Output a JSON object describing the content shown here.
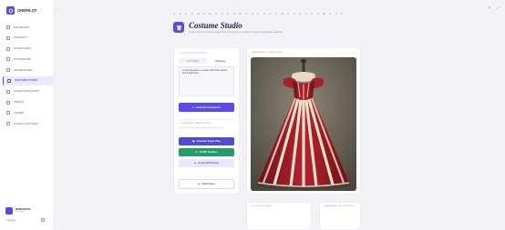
{
  "app": {
    "logo_text": "ONEPILOT",
    "collapse_icon": "‹‹"
  },
  "sidebar": {
    "items": [
      {
        "label": "DASHBOARD",
        "icon": "home-icon"
      },
      {
        "label": "PROJECTS",
        "icon": "folder-icon"
      },
      {
        "label": "CHARACTERS",
        "icon": "user-icon"
      },
      {
        "label": "STORYBOARD",
        "icon": "grid-icon"
      },
      {
        "label": "ONLINE MODEL",
        "icon": "cube-icon"
      },
      {
        "label": "COSTUME STUDIO",
        "icon": "shirt-icon",
        "active": true
      },
      {
        "label": "CHARACTER STUDIO",
        "icon": "face-icon"
      },
      {
        "label": "ASSETS",
        "icon": "image-icon"
      },
      {
        "label": "SHARED",
        "icon": "share-icon"
      },
      {
        "label": "USAGE & SETTINGS",
        "icon": "gear-icon"
      }
    ],
    "account": {
      "name": "WORKSPACE",
      "plan": "Free plan"
    },
    "upgrade": "• Upgrade"
  },
  "header": {
    "title": "Costume Studio",
    "subtitle": "Create character costume designs from text prompts or reference images and generate variations."
  },
  "left_panel": {
    "section1": "1. DESIGN DESCRIPTION",
    "tabs": [
      "Text Prompt",
      "Reference"
    ],
    "prompt_text": "A red long gown in a gown with white stripes and cream layer",
    "generate_button": "Generate Concept Art",
    "section2": "2. GENERATE VIEWS OF ART",
    "section2_hint": "Select the output after generating the concept",
    "single_view_button": "Generate Single View",
    "rotation_button": "AI 360° Rotation",
    "preview_button": "Instant 3D Preview",
    "new_project_button": "New Project"
  },
  "right_panel": {
    "title": "GENERATED CONCEPT ART",
    "close": "×"
  },
  "bottom_panels": {
    "left_title": "3D SINGLE VIEWS",
    "right_title": "GENERATED 360 ROTATION"
  },
  "colors": {
    "accent": "#5a48f5",
    "green": "#1e9e6a",
    "gown_red": "#a8202a"
  }
}
